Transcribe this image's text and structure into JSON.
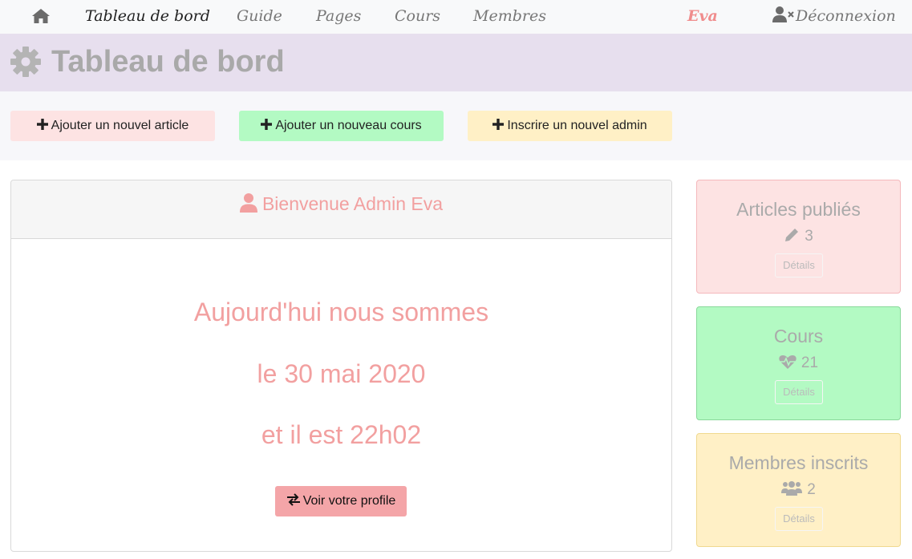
{
  "nav": {
    "home_icon": "home-icon",
    "items": [
      {
        "label": "Tableau de bord",
        "active": true
      },
      {
        "label": "Guide"
      },
      {
        "label": "Pages"
      },
      {
        "label": "Cours"
      },
      {
        "label": "Membres"
      }
    ],
    "user": "Eva",
    "logout_icon": "user-times-icon",
    "logout": "Déconnexion"
  },
  "header": {
    "icon": "gear-icon",
    "title": "Tableau de bord"
  },
  "actions": {
    "add_article": "Ajouter un nouvel article",
    "add_cours": "Ajouter un nouveau cours",
    "add_admin": "Inscrire un nouvel admin"
  },
  "main": {
    "welcome": "Bienvenue Admin Eva",
    "line1": "Aujourd'hui nous sommes",
    "line2": "le 30 mai 2020",
    "line3": "et il est 22h02",
    "profile_button": "Voir votre profile"
  },
  "cards": [
    {
      "title": "Articles publiés",
      "icon": "pencil-icon",
      "count": "3",
      "details": "Détails"
    },
    {
      "title": "Cours",
      "icon": "heartbeat-icon",
      "count": "21",
      "details": "Détails"
    },
    {
      "title": "Membres inscrits",
      "icon": "users-icon",
      "count": "2",
      "details": "Détails"
    }
  ],
  "colors": {
    "nav_bg": "#f8f9fa",
    "header_bg": "#e7dfee",
    "pink": "#fde3e3",
    "green": "#b3fac3",
    "yellow": "#fff0c6",
    "accent_text": "#f2a0a0",
    "profile_button": "#f4a5a8"
  }
}
